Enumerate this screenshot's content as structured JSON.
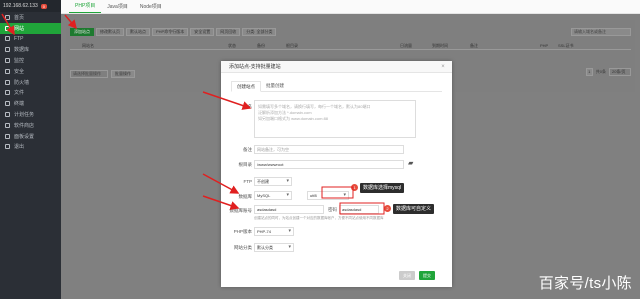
{
  "sidebar": {
    "ip": "192.168.62.133",
    "badge": "0",
    "items": [
      {
        "label": "首页"
      },
      {
        "label": "网站"
      },
      {
        "label": "FTP"
      },
      {
        "label": "数据库"
      },
      {
        "label": "监控"
      },
      {
        "label": "安全"
      },
      {
        "label": "防火墙"
      },
      {
        "label": "文件"
      },
      {
        "label": "终端"
      },
      {
        "label": "计划任务"
      },
      {
        "label": "软件商店"
      },
      {
        "label": "面板设置"
      },
      {
        "label": "退出"
      }
    ]
  },
  "topbar": {
    "tabs": [
      "PHP项目",
      "Java项目",
      "Node项目"
    ]
  },
  "toolbar": {
    "buttons": [
      "添加站点",
      "修改默认页",
      "默认站点",
      "PHP命令行版本",
      "安全设置",
      "网页回收",
      "分类: 全部分类"
    ]
  },
  "search": {
    "placeholder": "请输入域名或备注"
  },
  "table": {
    "headers": [
      "网站名",
      "状态",
      "备份",
      "根目录",
      "日流量",
      "到期时间",
      "备注",
      "PHP",
      "SSL证书"
    ]
  },
  "batch": {
    "select": "请选择批量操作",
    "button": "批量操作"
  },
  "pager": {
    "page": "1",
    "total": "共0条",
    "per_page": "20条/页"
  },
  "modal": {
    "title": "添加站点-支持批量建站",
    "tabs": [
      "创建站点",
      "批量创建"
    ],
    "domain_label": "域名",
    "domain_hints": [
      "如需填写多个域名，请换行填写，每行一个域名，默认为80端口",
      "泛解析添加方法 *.domain.com",
      "如另加端口格式为 www.domain.com:88"
    ],
    "remark_label": "备注",
    "remark_placeholder": "网站备注，可为空",
    "root_label": "根目录",
    "root_value": "/www/wwwroot",
    "ftp_label": "FTP",
    "ftp_value": "不创建",
    "db_label": "数据库",
    "db_value": "MySQL",
    "charset_value": "utf8",
    "db_account_label": "数据库账号",
    "db_account_value": "asdasdasd",
    "password_label": "密码",
    "password_value": "asdasdasd",
    "db_hint": "创建站点的同时，为站点创建一个对应的数据库帐户，方便不同站点使用不同数据库",
    "php_label": "PHP版本",
    "php_value": "PHP-74",
    "category_label": "网站分类",
    "category_value": "默认分类",
    "close_button": "关闭",
    "submit_button": "提交"
  },
  "callouts": [
    {
      "num": "1",
      "text": "数据库选择mysql"
    },
    {
      "num": "2",
      "text": "数据库可自定义"
    }
  ],
  "watermark": "百家号/ts小陈"
}
